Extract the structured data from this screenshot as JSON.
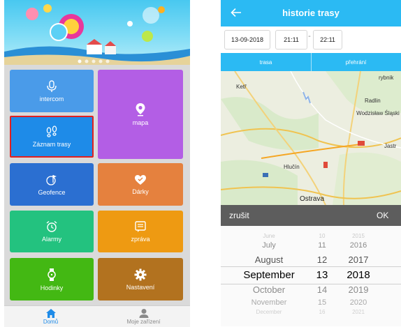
{
  "left_app": {
    "tiles": [
      {
        "label": "intercom",
        "icon": "microphone-icon",
        "color": "#4a9be9"
      },
      {
        "label": "mapa",
        "icon": "map-pin-icon",
        "color": "#b35ee5"
      },
      {
        "label": "Záznam trasy",
        "icon": "footprints-icon",
        "color": "#1e8be8"
      },
      {
        "label": "Geofence",
        "icon": "geofence-icon",
        "color": "#2b6fd1"
      },
      {
        "label": "Dárky",
        "icon": "gift-heart-icon",
        "color": "#e5813e"
      },
      {
        "label": "Alarmy",
        "icon": "alarm-clock-icon",
        "color": "#23c27f"
      },
      {
        "label": "zpráva",
        "icon": "message-icon",
        "color": "#ee9a12"
      },
      {
        "label": "Hodinky",
        "icon": "watch-icon",
        "color": "#43b813"
      },
      {
        "label": "Nastavení",
        "icon": "gear-icon",
        "color": "#b2721f"
      }
    ],
    "highlight_color": "#e02020",
    "bottom_tabs": [
      {
        "label": "Domů",
        "icon": "home-icon",
        "active": true,
        "color": "#1e8be8"
      },
      {
        "label": "Moje zařízení",
        "icon": "person-icon",
        "active": false,
        "color": "#8a8a8a"
      }
    ]
  },
  "right_app": {
    "header": {
      "title": "historie trasy",
      "back_icon": "back-arrow-icon",
      "color": "#2bbaf3"
    },
    "date_field": "13-09-2018",
    "time_start": "21:11",
    "time_separator": "-",
    "time_end": "22:11",
    "tabs": [
      "trasa",
      "přehrání"
    ],
    "map_labels": [
      "rybnik",
      "Ketř",
      "Radlin",
      "Wodzisław Śląski",
      "Jastr",
      "Hlučín",
      "Ostrava"
    ],
    "picker_bar": {
      "cancel": "zrušit",
      "ok": "OK"
    },
    "picker": {
      "months": [
        "June",
        "July",
        "August",
        "September",
        "October",
        "November",
        "December"
      ],
      "days": [
        "10",
        "11",
        "12",
        "13",
        "14",
        "15",
        "16"
      ],
      "years": [
        "2015",
        "2016",
        "2017",
        "2018",
        "2019",
        "2020",
        "2021"
      ]
    }
  }
}
